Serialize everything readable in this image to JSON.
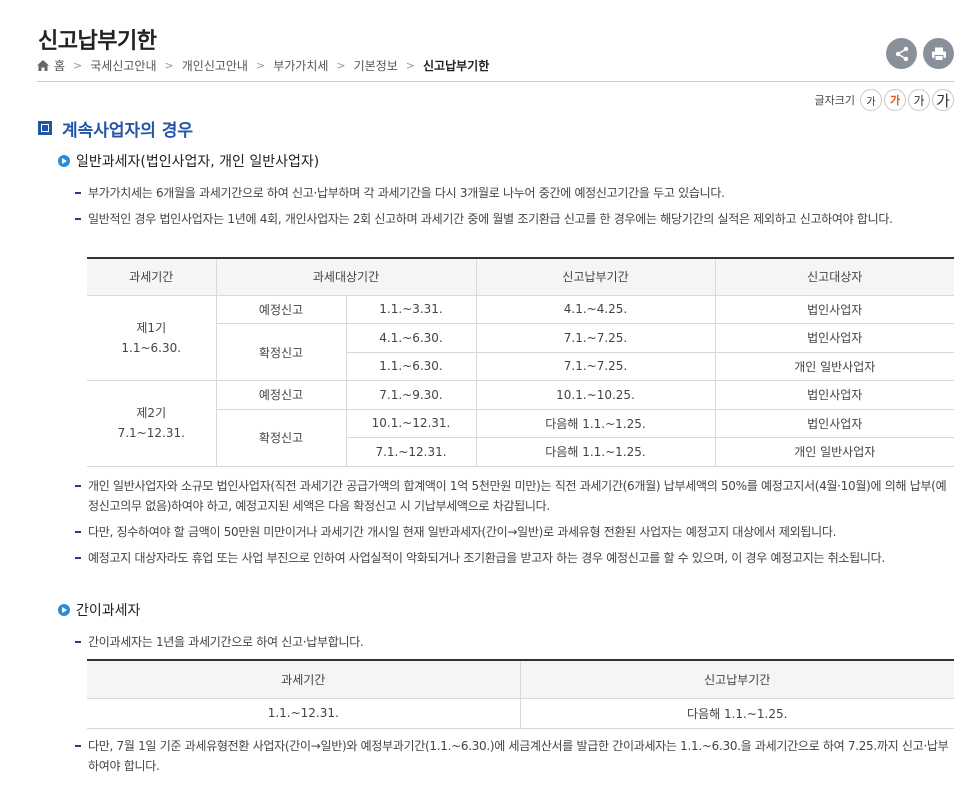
{
  "header": {
    "title": "신고납부기한",
    "breadcrumb": [
      "홈",
      "국세신고안내",
      "개인신고안내",
      "부가가치세",
      "기본정보",
      "신고납부기한"
    ]
  },
  "toolbar": {
    "share_icon": "share-icon",
    "print_icon": "print-icon",
    "font_label": "글자크기",
    "font_sizes": [
      "가",
      "가",
      "가",
      "가"
    ]
  },
  "section": {
    "title": "계속사업자의 경우",
    "general": {
      "title": "일반과세자(법인사업자, 개인 일반사업자)",
      "bullets": [
        "부가가치세는 6개월을 과세기간으로 하여 신고·납부하며 각 과세기간을 다시 3개월로 나누어 중간에 예정신고기간을 두고 있습니다.",
        "일반적인 경우 법인사업자는 1년에 4회, 개인사업자는 2회 신고하며 과세기간 중에 월별 조기환급 신고를 한 경우에는 해당기간의 실적은 제외하고 신고하여야 합니다."
      ],
      "table": {
        "headers": [
          "과세기간",
          "과세대상기간",
          "신고납부기간",
          "신고대상자"
        ],
        "period1": "제1기 1.1~6.30.",
        "period2": "제2기 7.1~12.31.",
        "rows": [
          {
            "type": "예정신고",
            "range": "1.1.~3.31.",
            "due": "4.1.~4.25.",
            "target": "법인사업자"
          },
          {
            "type": "확정신고",
            "range": "4.1.~6.30.",
            "due": "7.1.~7.25.",
            "target": "법인사업자"
          },
          {
            "type": "",
            "range": "1.1.~6.30.",
            "due": "7.1.~7.25.",
            "target": "개인 일반사업자"
          },
          {
            "type": "예정신고",
            "range": "7.1.~9.30.",
            "due": "10.1.~10.25.",
            "target": "법인사업자"
          },
          {
            "type": "확정신고",
            "range": "10.1.~12.31.",
            "due": "다음해 1.1.~1.25.",
            "target": "법인사업자"
          },
          {
            "type": "",
            "range": "7.1.~12.31.",
            "due": "다음해 1.1.~1.25.",
            "target": "개인 일반사업자"
          }
        ]
      },
      "bullets2": [
        "개인 일반사업자와 소규모 법인사업자(직전 과세기간 공급가액의 합계액이 1억 5천만원 미만)는 직전 과세기간(6개월) 납부세액의 50%를 예정고지서(4월·10월)에 의해 납부(예정신고의무 없음)하여야 하고, 예정고지된 세액은 다음 확정신고 시 기납부세액으로 차감됩니다.",
        "다만, 징수하여야 할 금액이 50만원 미만이거나 과세기간 개시일 현재 일반과세자(간이→일반)로 과세유형 전환된 사업자는 예정고지 대상에서 제외됩니다.",
        "예정고지 대상자라도 휴업 또는 사업 부진으로 인하여 사업실적이 악화되거나 조기환급을 받고자 하는 경우 예정신고를 할 수 있으며, 이 경우 예정고지는 취소됩니다."
      ]
    },
    "simple": {
      "title": "간이과세자",
      "bullet1": "간이과세자는 1년을 과세기간으로 하여 신고·납부합니다.",
      "table": {
        "headers": [
          "과세기간",
          "신고납부기간"
        ],
        "row": [
          "1.1.~12.31.",
          "다음해 1.1.~1.25."
        ]
      },
      "bullet2": "다만, 7월 1일 기준 과세유형전환 사업자(간이→일반)와 예정부과기간(1.1.~6.30.)에 세금계산서를 발급한 간이과세자는 1.1.~6.30.을 과세기간으로 하여 7.25.까지 신고·납부하여야 합니다."
    }
  }
}
